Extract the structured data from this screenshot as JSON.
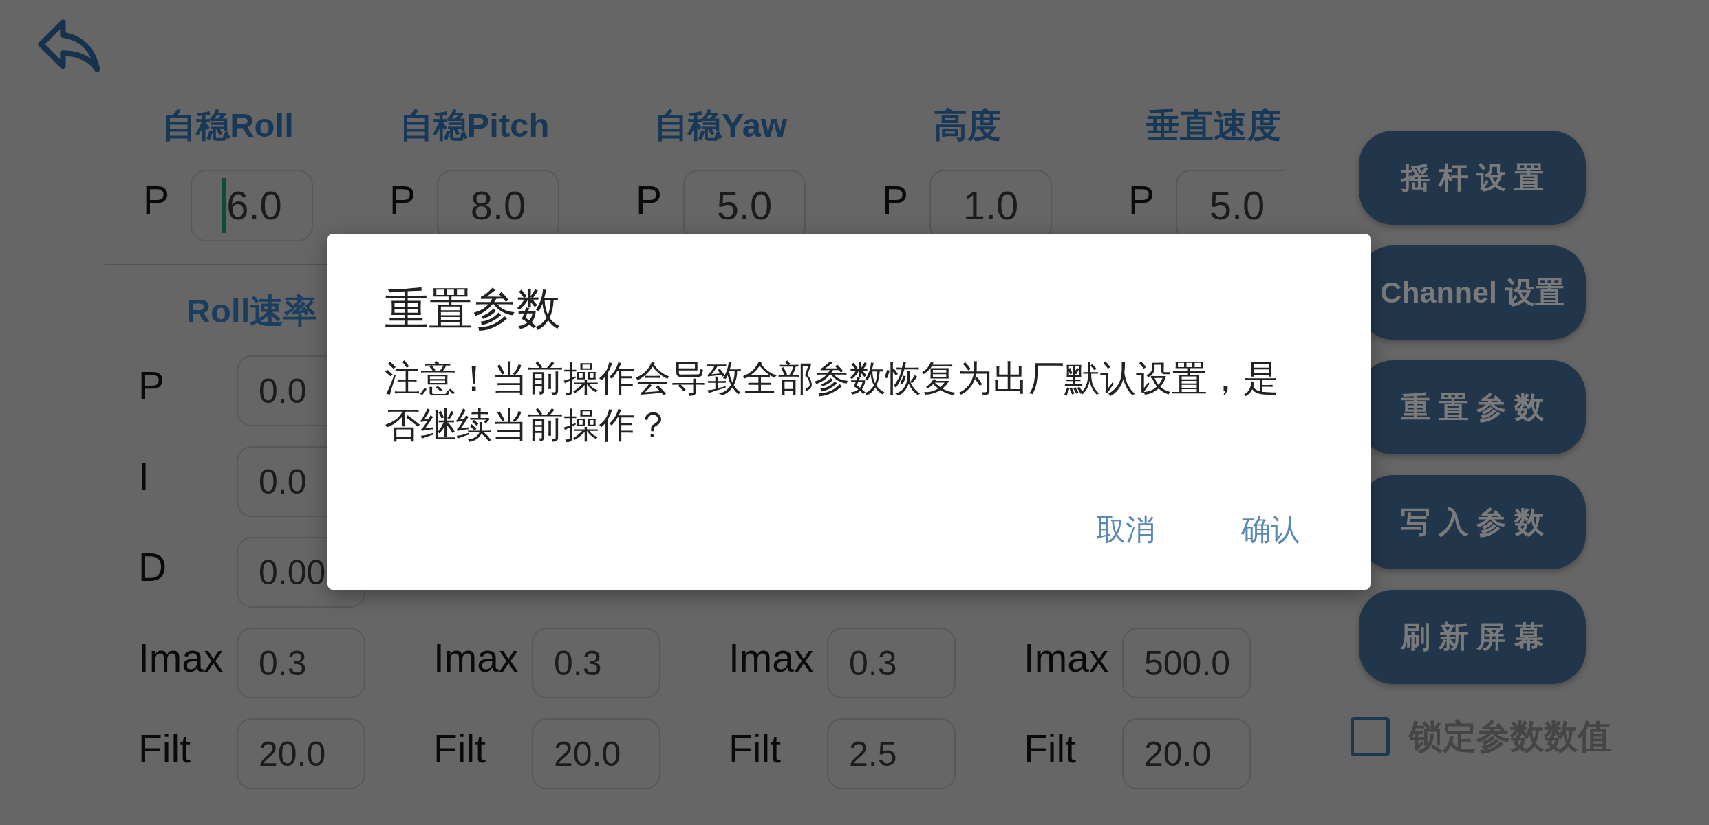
{
  "stabilize_section": {
    "columns": [
      {
        "heading": "自稳Roll",
        "params": [
          {
            "label": "P",
            "value": "6.0",
            "focused": true
          }
        ]
      },
      {
        "heading": "自稳Pitch",
        "params": [
          {
            "label": "P",
            "value": "8.0",
            "focused": false
          }
        ]
      },
      {
        "heading": "自稳Yaw",
        "params": [
          {
            "label": "P",
            "value": "5.0",
            "focused": false
          }
        ]
      },
      {
        "heading": "高度",
        "params": [
          {
            "label": "P",
            "value": "1.0",
            "focused": false
          }
        ]
      },
      {
        "heading": "垂直速度",
        "params": [
          {
            "label": "P",
            "value": "5.0",
            "focused": false
          }
        ]
      }
    ]
  },
  "rate_section": {
    "columns": [
      {
        "heading": "Roll速率",
        "params": [
          {
            "label": "P",
            "value": "0.0",
            "focused": false
          },
          {
            "label": "I",
            "value": "0.0",
            "focused": false
          },
          {
            "label": "D",
            "value": "0.00",
            "focused": false
          },
          {
            "label": "Imax",
            "value": "0.3",
            "focused": false
          },
          {
            "label": "Filt",
            "value": "20.0",
            "focused": false
          }
        ]
      },
      {
        "params": [
          {
            "label": "Imax",
            "value": "0.3",
            "focused": false
          },
          {
            "label": "Filt",
            "value": "20.0",
            "focused": false
          }
        ]
      },
      {
        "params": [
          {
            "label": "Imax",
            "value": "0.3",
            "focused": false
          },
          {
            "label": "Filt",
            "value": "2.5",
            "focused": false
          }
        ]
      },
      {
        "params": [
          {
            "label": "Imax",
            "value": "500.0",
            "focused": false
          },
          {
            "label": "Filt",
            "value": "20.0",
            "focused": false
          }
        ]
      }
    ]
  },
  "side_buttons": [
    "摇 杆 设 置",
    "Channel 设置",
    "重 置 参 数",
    "写 入 参 数",
    "刷 新 屏 幕"
  ],
  "lock_values": {
    "label": "锁定参数数值",
    "checked": false
  },
  "dialog": {
    "title": "重置参数",
    "message": "注意！当前操作会导致全部参数恢复为出厂默认设置，是否继续当前操作？",
    "buttons": [
      "取消",
      "确认"
    ]
  }
}
